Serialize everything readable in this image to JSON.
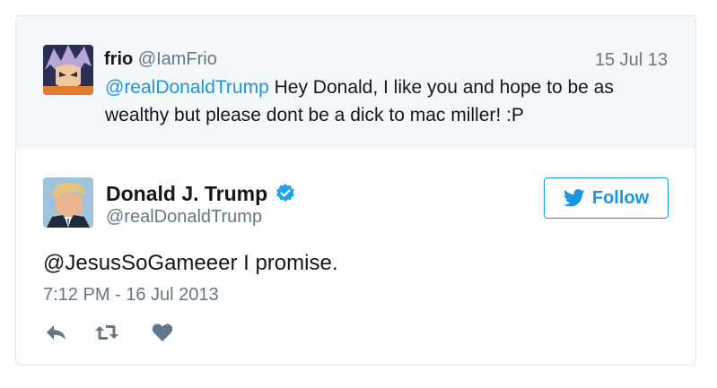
{
  "parent_tweet": {
    "name": "frio",
    "handle": "@IamFrio",
    "date": "15 Jul 13",
    "mention": "@realDonaldTrump",
    "text": " Hey Donald, I like you and hope to be as wealthy but please dont be a dick to mac miller! :P"
  },
  "main_tweet": {
    "name": "Donald J. Trump",
    "handle": "@realDonaldTrump",
    "follow_label": "Follow",
    "text": "@JesusSoGameeer I promise.",
    "timestamp": "7:12 PM - 16 Jul 2013"
  },
  "icons": {
    "verified": "verified-badge-icon",
    "follow": "twitter-bird-icon",
    "reply": "reply-icon",
    "retweet": "retweet-icon",
    "like": "heart-icon"
  },
  "colors": {
    "accent": "#1b95e0",
    "muted": "#657786",
    "parent_bg": "#f5f8fa",
    "border": "#e1e8ed"
  }
}
